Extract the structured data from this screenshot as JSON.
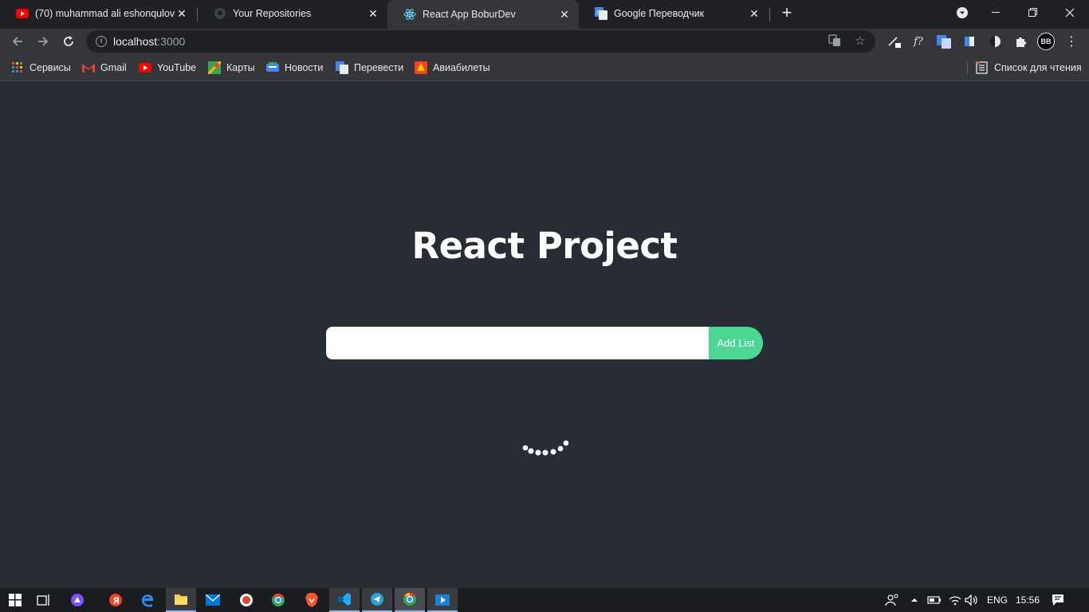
{
  "browser": {
    "tabs": [
      {
        "title": "(70) muhammad ali eshonqulov -",
        "favicon": "youtube-icon"
      },
      {
        "title": "Your Repositories",
        "favicon": "github-icon"
      },
      {
        "title": "React App BoburDev",
        "favicon": "react-icon"
      },
      {
        "title": "Google Переводчик",
        "favicon": "google-translate-icon"
      }
    ],
    "new_tab": "+",
    "url_host": "localhost",
    "url_port": ":3000",
    "profile_initials": "BB",
    "extension_text": "f?",
    "bookmarks": [
      {
        "label": "Сервисы",
        "icon": "apps-grid-icon"
      },
      {
        "label": "Gmail",
        "icon": "gmail-icon"
      },
      {
        "label": "YouTube",
        "icon": "youtube-icon"
      },
      {
        "label": "Карты",
        "icon": "maps-icon"
      },
      {
        "label": "Новости",
        "icon": "news-icon"
      },
      {
        "label": "Перевести",
        "icon": "translate-icon"
      },
      {
        "label": "Авиабилеты",
        "icon": "flights-icon"
      }
    ],
    "reading_list": "Список для чтения"
  },
  "page": {
    "heading": "React Project",
    "input_value": "",
    "input_placeholder": "",
    "add_button": "Add List",
    "colors": {
      "background": "#282c34",
      "button": "#4cd694"
    }
  },
  "taskbar": {
    "language": "ENG",
    "time": "15:56"
  }
}
